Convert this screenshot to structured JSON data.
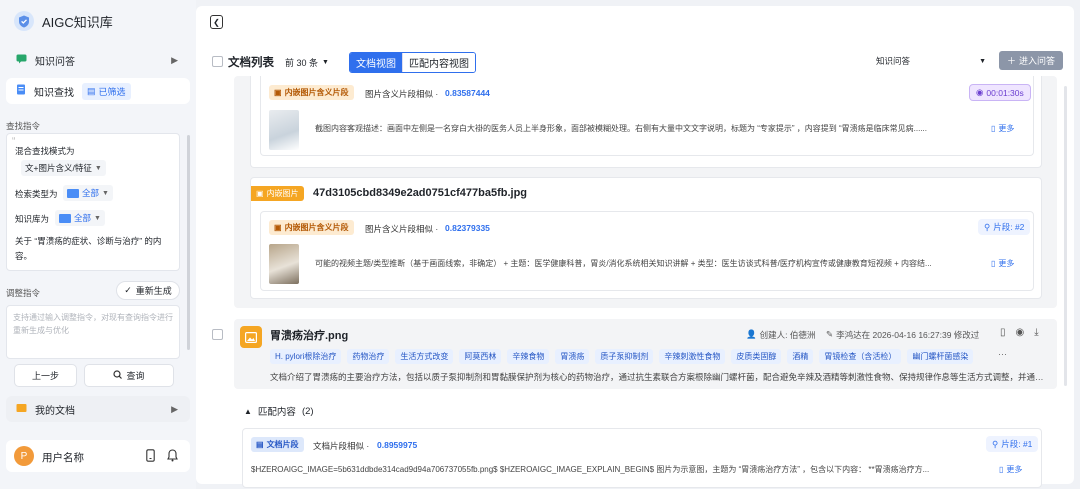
{
  "app": {
    "title": "AIGC知识库"
  },
  "sidebar": {
    "nav_qa": "知识问答",
    "nav_search": "知识查找",
    "filtered_badge": "已筛选",
    "search_cmd_label": "查找指令",
    "mix_mode_label": "混合查找模式为",
    "mix_mode_value": "文+图片含义/特征",
    "type_label": "检索类型为",
    "type_value": "全部",
    "kb_label": "知识库为",
    "kb_value": "全部",
    "query_text": "关于 “胃溃疡的症状、诊断与治疗” 的内容。",
    "adjust_label": "调整指令",
    "regen_button": "重新生成",
    "adjust_placeholder": "支持通过输入调整指令，对现有查询指令进行重新生成与优化",
    "prev_button": "上一步",
    "query_button": "查询",
    "my_docs": "我的文档",
    "user_name": "用户名称",
    "user_initial": "P"
  },
  "toolbar": {
    "doc_list": "文档列表",
    "top_n": "前 30 条",
    "view_doc": "文档视图",
    "view_match": "匹配内容视图",
    "qa_select": "知识问答",
    "enter_qa": "进入问答"
  },
  "result1": {
    "tag": "内嵌图片含义片段",
    "sim_label": "图片含义片段相似 ·",
    "sim_value": "0.83587444",
    "time": "00:01:30s",
    "snippet": "截图内容客观描述：画面中左侧是一名穿白大褂的医务人员上半身形象，面部被模糊处理。右侧有大量中文文字说明，标题为 “专家提示” ，内容提到 “胃溃疡是临床常见病......",
    "more": "更多"
  },
  "result2": {
    "file_tag": "内嵌图片",
    "file_name": "47d3105cbd8349e2ad0751cf477ba5fb.jpg",
    "tag": "内嵌图片含义片段",
    "sim_label": "图片含义片段相似 ·",
    "sim_value": "0.82379335",
    "segment": "片段: #2",
    "snippet": "可能的视频主题/类型推断（基于画面线索，非确定） + 主题：医学健康科普，胃炎/消化系统相关知识讲解 + 类型：医生访谈式科普/医疗机构宣传或健康教育短视频 + 内容结...",
    "more": "更多"
  },
  "doc": {
    "title": "胃溃疡治疗.png",
    "creator": "创建人: 伯德洲",
    "modified": "李鸿达在 2026-04-16 16:27:39 修改过",
    "keywords": [
      "H. pylori根除治疗",
      "药物治疗",
      "生活方式改变",
      "阿莫西林",
      "辛辣食物",
      "胃溃疡",
      "质子泵抑制剂",
      "辛辣刺激性食物",
      "皮质类固醇",
      "酒精",
      "胃镜检查（含活检）",
      "幽门螺杆菌感染"
    ],
    "summary": "文档介绍了胃溃疡的主要治疗方法，包括以质子泵抑制剂和胃黏膜保护剂为核心的药物治疗，通过抗生素联合方案根除幽门螺杆菌，配合避免辛辣及酒精等刺激性食物、保持规律作息等生活方式调整，并通过...",
    "match_label": "匹配内容",
    "match_count": "(2)",
    "match_tag": "文档片段",
    "match_sim_label": "文档片段相似 ·",
    "match_sim_value": "0.8959975",
    "match_segment": "片段: #1",
    "match_snippet": "$HZEROAIGC_IMAGE=5b631ddbde314cad9d94a706737055fb.png$ $HZEROAIGC_IMAGE_EXPLAIN_BEGIN$ 图片为示意图，主题为 “胃溃疡治疗方法” ，包含以下内容： **胃溃疡治疗方...",
    "match_more": "更多"
  },
  "colors": {
    "accent": "#2f6fed",
    "orange": "#f5a623",
    "purple": "#6b3fd0"
  }
}
